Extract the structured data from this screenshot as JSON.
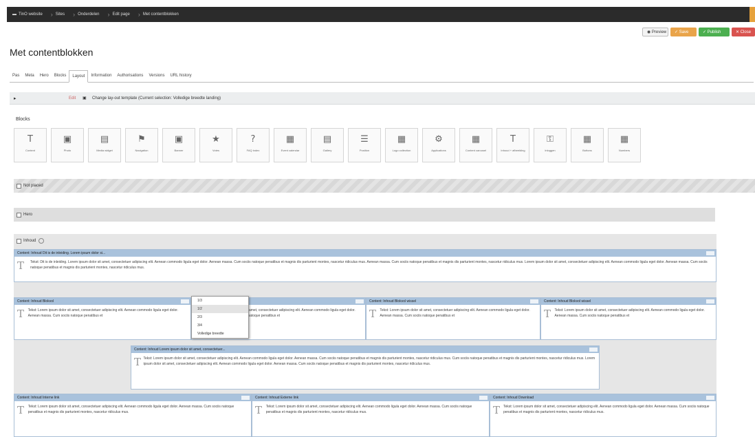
{
  "breadcrumb": [
    "TinO website",
    "Sites",
    "Onderdelen",
    "Edit page",
    "Met contentblokken"
  ],
  "actions": {
    "preview": "Preview",
    "save": "Save",
    "publish": "Publish",
    "close": "Close"
  },
  "page_title": "Met contentblokken",
  "tabs": [
    "Pas",
    "Meta",
    "Hero",
    "Blocks",
    "Layout",
    "Information",
    "Authorisations",
    "Versions",
    "URL history"
  ],
  "active_tab_index": 4,
  "layout_bar": {
    "arrow": "▸",
    "edit": "Edit",
    "text": "Change lay-out template (Current selection: Volledige breedte landing)"
  },
  "blocks_label": "Blocks",
  "blocks": [
    {
      "icon": "text-icon",
      "glyph": "T",
      "label": "Content"
    },
    {
      "icon": "photo-icon",
      "glyph": "▣",
      "label": "Photo"
    },
    {
      "icon": "media-widget-icon",
      "glyph": "▤",
      "label": "Media widget"
    },
    {
      "icon": "flag-icon",
      "glyph": "⚑",
      "label": "Navigation"
    },
    {
      "icon": "image-icon",
      "glyph": "▣",
      "label": "Banner"
    },
    {
      "icon": "star-icon",
      "glyph": "★",
      "label": "Votes"
    },
    {
      "icon": "question-icon",
      "glyph": "?",
      "label": "FAQ index"
    },
    {
      "icon": "calendar-icon",
      "glyph": "▦",
      "label": "Event calendar"
    },
    {
      "icon": "gallery-icon",
      "glyph": "▤",
      "label": "Gallery"
    },
    {
      "icon": "list-icon",
      "glyph": "☰",
      "label": "Position"
    },
    {
      "icon": "logo-collection-icon",
      "glyph": "▦",
      "label": "Logo collection"
    },
    {
      "icon": "gears-icon",
      "glyph": "⚙",
      "label": "Applications"
    },
    {
      "icon": "grid-icon",
      "glyph": "▦",
      "label": "Content carousel"
    },
    {
      "icon": "text-attached-icon",
      "glyph": "T",
      "label": "Inhoud + afbeelding"
    },
    {
      "icon": "lock-icon",
      "glyph": "⚿",
      "label": "Inloggen"
    },
    {
      "icon": "grid-icon",
      "glyph": "▦",
      "label": "Buttons"
    },
    {
      "icon": "grid-icon",
      "glyph": "▦",
      "label": "Numbers"
    }
  ],
  "zones": {
    "not_placed": "Not placed",
    "hero": "Hero",
    "inhoud": "Inhoud"
  },
  "content_blocks": [
    {
      "title": "Content: Inhoud Dit is de inleiding. Lorem ipsum dolor si...",
      "text": "Tekst: Dit is de inleiding. Lorem ipsum dolor sit amet, consectetuer adipiscing elit. Aenean commodo ligula eget dolor. Aenean massa. Cum sociis natoque penatibus et magnis dis parturient montes, nascetur ridiculus mus. Aenean massa. Cum sociis natoque penatibus et magnis dis parturient montes, nascetur ridiculus mus. Lorem ipsum dolor sit amet, consectetuer adipiscing elit. Aenean commodo ligula eget dolor. Aenean massa. Cum sociis natoque penatibus et magnis dis parturient montes, nascetur ridiculus mus."
    },
    {
      "title": "Content: Inhoud Blokvol",
      "text": "Tekst: Lorem ipsum dolor sit amet, consectetuer adipiscing elit. Aenean commodo ligula eget dolor. Aenean massa. Cum sociis natoque penatibus et"
    },
    {
      "title": "Content: Inhoud Blokvol",
      "text": "Tekst: Lorem ipsum dolor sit amet, consectetuer adipiscing elit. Aenean commodo ligula eget dolor. Aenean massa. Cum sociis natoque penatibus et"
    },
    {
      "title": "Content: Inhoud Blokvol wissel",
      "text": "Tekst: Lorem ipsum dolor sit amet, consectetuer adipiscing elit. Aenean commodo ligula eget dolor. Aenean massa. Cum sociis natoque penatibus et"
    },
    {
      "title": "Content: Inhoud Blokvol wissel",
      "text": "Tekst: Lorem ipsum dolor sit amet, consectetuer adipiscing elit. Aenean commodo ligula eget dolor. Aenean massa. Cum sociis natoque penatibus et"
    },
    {
      "title": "Content: Inhoud Lorem ipsum dolor sit amet, consectetuer...",
      "text": "Tekst: Lorem ipsum dolor sit amet, consectetuer adipiscing elit. Aenean commodo ligula eget dolor. Aenean massa. Cum sociis natoque penatibus et magnis dis parturient montes, nascetur ridiculus mus. Cum sociis natoque penatibus et magnis dis parturient montes, nascetur ridiculus mus. Lorem ipsum dolor sit amet, consectetuer adipiscing elit. Aenean commodo ligula eget dolor. Aenean massa. Cum sociis natoque penatibus et magnis dis parturient montes, nascetur ridiculus mus."
    },
    {
      "title": "Content: Inhoud Interne link",
      "text": "Tekst: Lorem ipsum dolor sit amet, consectetuer adipiscing elit. Aenean commodo ligula eget dolor. Aenean massa. Cum sociis natoque penatibus et magnis dis parturient montes, nascetur ridiculus mus."
    },
    {
      "title": "Content: Inhoud Externe link",
      "text": "Tekst: Lorem ipsum dolor sit amet, consectetuer adipiscing elit. Aenean commodo ligula eget dolor. Aenean massa. Cum sociis natoque penatibus et magnis dis parturient montes, nascetur ridiculus mus."
    },
    {
      "title": "Content: Inhoud Download",
      "text": "Tekst: Lorem ipsum dolor sit amet, consectetuer adipiscing elit. Aenean commodo ligula eget dolor. Aenean massa. Cum sociis natoque penatibus et magnis dis parturient montes, nascetur ridiculus mus."
    }
  ],
  "width_dropdown": [
    "1/3",
    "1/2",
    "2/3",
    "3/4",
    "Volledige breedte"
  ],
  "width_dropdown_highlight": 1
}
